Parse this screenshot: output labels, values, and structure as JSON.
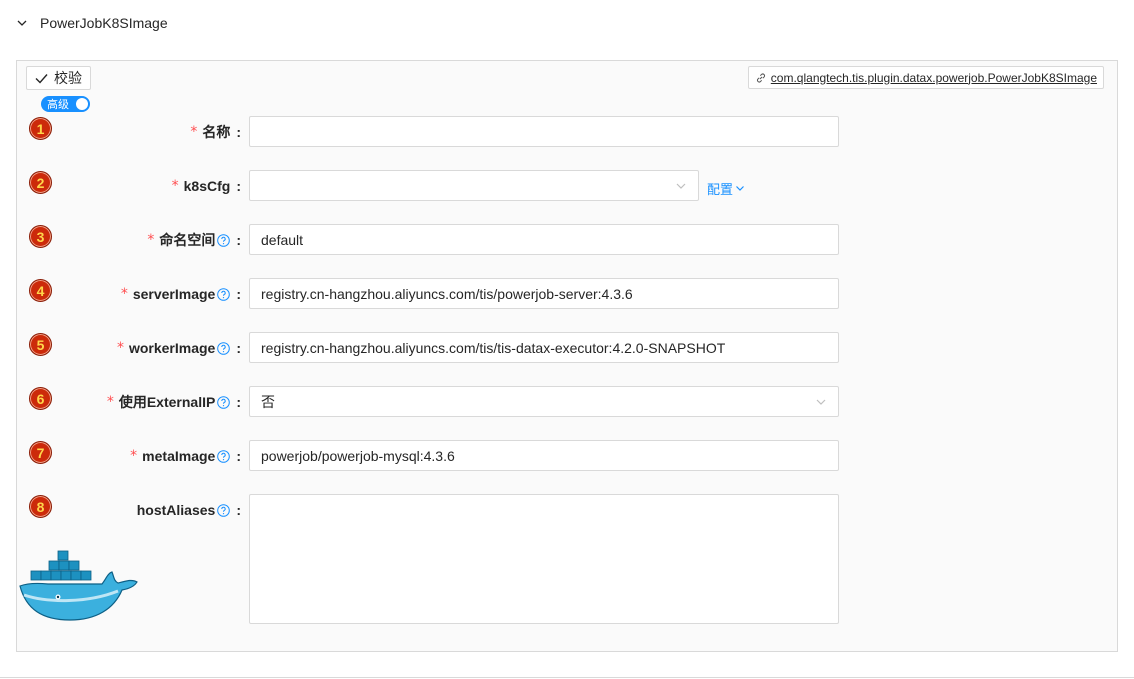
{
  "collapse": {
    "title": "PowerJobK8SImage"
  },
  "toolbar": {
    "verify_label": "校验",
    "impl_link": "com.qlangtech.tis.plugin.datax.powerjob.PowerJobK8SImage",
    "advanced_label": "高级"
  },
  "fields": [
    {
      "num": "1",
      "required": "*",
      "label": "名称",
      "value": ""
    },
    {
      "num": "2",
      "required": "*",
      "label": "k8sCfg",
      "value": "",
      "action": "配置"
    },
    {
      "num": "3",
      "required": "*",
      "label": "命名空间",
      "value": "default"
    },
    {
      "num": "4",
      "required": "*",
      "label": "serverImage",
      "value": "registry.cn-hangzhou.aliyuncs.com/tis/powerjob-server:4.3.6"
    },
    {
      "num": "5",
      "required": "*",
      "label": "workerImage",
      "value": "registry.cn-hangzhou.aliyuncs.com/tis/tis-datax-executor:4.2.0-SNAPSHOT"
    },
    {
      "num": "6",
      "required": "*",
      "label": "使用ExternalIP",
      "value": "否"
    },
    {
      "num": "7",
      "required": "*",
      "label": "metaImage",
      "value": "powerjob/powerjob-mysql:4.3.6"
    },
    {
      "num": "8",
      "required": "",
      "label": "hostAliases",
      "value": ""
    }
  ],
  "colon": ":",
  "colors": {
    "primary": "#1890ff",
    "required": "#ff4d4f",
    "badge": "#cc2a0a",
    "docker": "#1d91c0"
  },
  "icons": {
    "collapse": "chevron-down-icon",
    "verify": "check-icon",
    "link": "link-icon",
    "help": "question-circle-icon",
    "select": "chevron-down-icon",
    "docker": "docker-whale-icon"
  }
}
